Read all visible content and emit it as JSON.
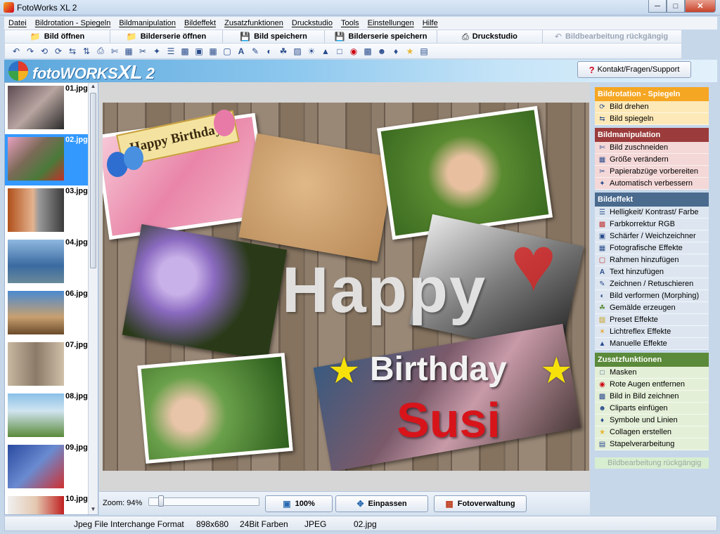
{
  "window": {
    "title": "FotoWorks XL 2"
  },
  "menu": [
    "Datei",
    "Bildrotation - Spiegeln",
    "Bildmanipulation",
    "Bildeffekt",
    "Zusatzfunktionen",
    "Druckstudio",
    "Tools",
    "Einstellungen",
    "Hilfe"
  ],
  "toolbar": {
    "open": "Bild öffnen",
    "open_series": "Bilderserie öffnen",
    "save": "Bild speichern",
    "save_series": "Bilderserie speichern",
    "print": "Druckstudio",
    "undo": "Bildbearbeitung rückgängig"
  },
  "logo": {
    "name": "fotoWORKS",
    "suffix": "XL",
    "version": "2"
  },
  "support_button": "Kontakt/Fragen/Support",
  "thumbnails": [
    "01.jpg",
    "02.jpg",
    "03.jpg",
    "04.jpg",
    "06.jpg",
    "07.jpg",
    "08.jpg",
    "09.jpg",
    "10.jpg"
  ],
  "selected_thumbnail": "02.jpg",
  "canvas": {
    "line1": "Happy",
    "line2": "Birthday",
    "line3": "Susi",
    "card_text": "Happy Birthday!"
  },
  "bottom": {
    "zoom_label": "Zoom: 94%",
    "btn_100": "100%",
    "btn_fit": "Einpassen",
    "btn_manager": "Fotoverwaltung"
  },
  "sections": [
    {
      "title": "Bildrotation - Spiegeln",
      "color": "#f5a623",
      "bg": "#fde9b8",
      "items": [
        "Bild drehen",
        "Bild spiegeln"
      ]
    },
    {
      "title": "Bildmanipulation",
      "color": "#9b3b3b",
      "bg": "#f4d8d8",
      "items": [
        "Bild zuschneiden",
        "Größe verändern",
        "Papierabzüge vorbereiten",
        "Automatisch verbessern"
      ]
    },
    {
      "title": "Bildeffekt",
      "color": "#4a6a8e",
      "bg": "#dde6f0",
      "items": [
        "Helligkeit/ Kontrast/ Farbe",
        "Farbkorrektur RGB",
        "Schärfer / Weichzeichner",
        "Fotografische Effekte",
        "Rahmen hinzufügen",
        "Text hinzufügen",
        "Zeichnen / Retuschieren",
        "Bild verformen (Morphing)",
        "Gemälde erzeugen",
        "Preset Effekte",
        "Lichtreflex Effekte",
        "Manuelle Effekte"
      ]
    },
    {
      "title": "Zusatzfunktionen",
      "color": "#5b8a3a",
      "bg": "#e4efd8",
      "items": [
        "Masken",
        "Rote Augen entfernen",
        "Bild in Bild zeichnen",
        "Cliparts einfügen",
        "Symbole und Linien",
        "Collagen erstellen",
        "Stapelverarbeitung"
      ]
    }
  ],
  "panel_undo": "Bildbearbeitung rückgängig",
  "status": {
    "format": "Jpeg File Interchange Format",
    "size": "898x680",
    "depth": "24Bit Farben",
    "type": "JPEG",
    "file": "02.jpg"
  }
}
